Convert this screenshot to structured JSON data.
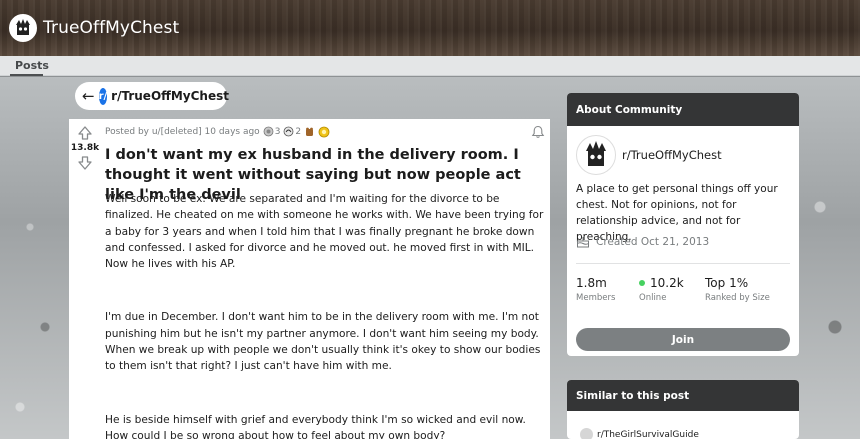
{
  "header": {
    "subreddit_title": "TrueOffMyChest",
    "tabs": [
      {
        "label": "Posts"
      }
    ]
  },
  "back_pill": {
    "icon": "back-arrow-icon",
    "subreddit": "r/TrueOffMyChest"
  },
  "post": {
    "vote_count": "13.8k",
    "meta": {
      "posted_by": "Posted by u/[deleted] 10 days ago",
      "awards": [
        {
          "icon": "award-icon",
          "count": "3"
        },
        {
          "icon": "award-icon",
          "count": "2"
        },
        {
          "icon": "award-icon",
          "count": ""
        },
        {
          "icon": "award-icon",
          "count": ""
        }
      ]
    },
    "title": "I don't want my ex husband in the delivery room. I thought it went without saying but now people act like I'm the devil",
    "body": [
      "Well soon to be ex. We are separated and I'm waiting for the divorce to be finalized. He cheated on me with someone he works with. We have been trying for a baby for 3 years and when I told him that I was finally pregnant he broke down and confessed. I asked for divorce and he moved out. he moved first in with MIL. Now he lives with his AP.",
      "I'm due in December. I don't want him to be in the delivery room with me. I'm not punishing him but he isn't my partner anymore. I don't want him seeing my body. When we break up with people we don't usually think it's okey to show our bodies to them isn't that right? I just can't have him with me.",
      "He is beside himself with grief and everybody think I'm so wicked and evil now. How could I be so wrong about how to feel about my own body?"
    ]
  },
  "sidebar": {
    "about": {
      "heading": "About Community",
      "subreddit": "r/TrueOffMyChest",
      "description": "A place to get personal things off your chest. Not for opinions, not for relationship advice, and not for preaching.",
      "created": "Created Oct 21, 2013",
      "stats": [
        {
          "value": "1.8m",
          "label": "Members"
        },
        {
          "value": "10.2k",
          "label": "Online"
        },
        {
          "value": "Top 1%",
          "label": "Ranked by Size"
        }
      ],
      "join_label": "Join"
    },
    "similar": {
      "heading": "Similar to this post",
      "items": [
        {
          "label": "r/TheGirlSurvivalGuide"
        }
      ]
    }
  },
  "colors": {
    "join_button": "#7c8082",
    "online_dot": "#46d160",
    "card_header": "#343536"
  }
}
